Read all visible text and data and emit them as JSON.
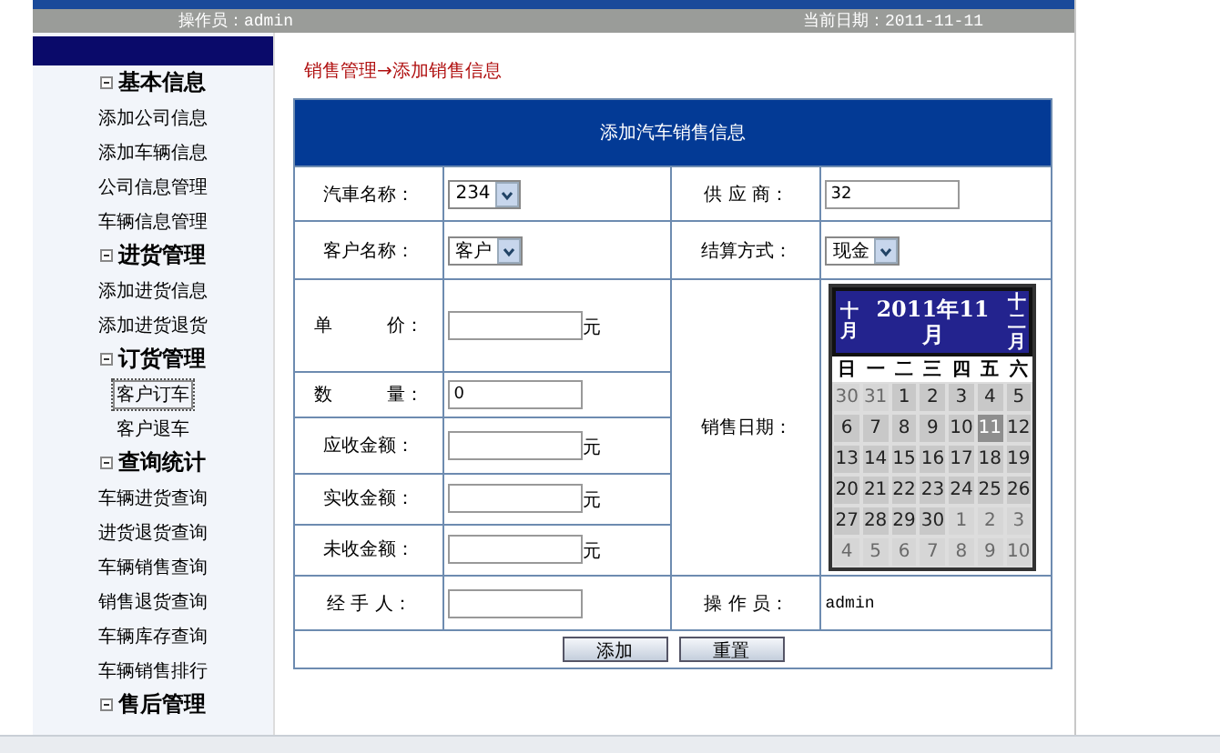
{
  "header": {
    "operator": "操作员：admin",
    "date": "当前日期：2011-11-11"
  },
  "sidebar": {
    "groups": [
      {
        "title": "基本信息",
        "expanded": true,
        "items": [
          {
            "label": "添加公司信息",
            "selected": false
          },
          {
            "label": "添加车辆信息",
            "selected": false
          },
          {
            "label": "公司信息管理",
            "selected": false
          },
          {
            "label": "车辆信息管理",
            "selected": false
          }
        ]
      },
      {
        "title": "进货管理",
        "expanded": true,
        "items": [
          {
            "label": "添加进货信息",
            "selected": false
          },
          {
            "label": "添加进货退货",
            "selected": false
          }
        ]
      },
      {
        "title": "订货管理",
        "expanded": true,
        "items": [
          {
            "label": "客户订车",
            "selected": true
          },
          {
            "label": "客户退车",
            "selected": false
          }
        ]
      },
      {
        "title": "查询统计",
        "expanded": true,
        "items": [
          {
            "label": "车辆进货查询",
            "selected": false
          },
          {
            "label": "进货退货查询",
            "selected": false
          },
          {
            "label": "车辆销售查询",
            "selected": false
          },
          {
            "label": "销售退货查询",
            "selected": false
          },
          {
            "label": "车辆库存查询",
            "selected": false
          },
          {
            "label": "车辆销售排行",
            "selected": false
          }
        ]
      },
      {
        "title": "售后管理",
        "expanded": true
      }
    ]
  },
  "breadcrumb": "销售管理→添加销售信息",
  "form": {
    "title": "添加汽车销售信息",
    "car_name": {
      "label": "汽車名称：",
      "value": "234"
    },
    "supplier": {
      "label": "供 应 商：",
      "value": "32"
    },
    "customer": {
      "label": "客户名称：",
      "value": "客户"
    },
    "settlement": {
      "label": "结算方式：",
      "value": "现金"
    },
    "unit_price": {
      "label": "单　　　价：",
      "unit": "元"
    },
    "quantity": {
      "label": "数　　　量：",
      "value": "0"
    },
    "receivable": {
      "label": "应收金额：",
      "unit": "元"
    },
    "received": {
      "label": "实收金额：",
      "unit": "元"
    },
    "outstanding": {
      "label": "未收金额：",
      "unit": "元"
    },
    "handler": {
      "label": "经 手 人："
    },
    "operator": {
      "label": "操 作 员：",
      "value": "admin"
    },
    "sale_date": {
      "label": "销售日期："
    },
    "buttons": [
      "添加",
      "重置"
    ]
  },
  "calendar": {
    "prev": "十月",
    "title": "2011年11月",
    "next": "十二月",
    "weekdays": [
      "日",
      "一",
      "二",
      "三",
      "四",
      "五",
      "六"
    ],
    "days": [
      {
        "label": "30",
        "muted": true,
        "selected": false
      },
      {
        "label": "31",
        "muted": true,
        "selected": false
      },
      {
        "label": "1",
        "muted": false,
        "selected": false
      },
      {
        "label": "2",
        "muted": false,
        "selected": false
      },
      {
        "label": "3",
        "muted": false,
        "selected": false
      },
      {
        "label": "4",
        "muted": false,
        "selected": false
      },
      {
        "label": "5",
        "muted": false,
        "selected": false
      },
      {
        "label": "6",
        "muted": false,
        "selected": false
      },
      {
        "label": "7",
        "muted": false,
        "selected": false
      },
      {
        "label": "8",
        "muted": false,
        "selected": false
      },
      {
        "label": "9",
        "muted": false,
        "selected": false
      },
      {
        "label": "10",
        "muted": false,
        "selected": false
      },
      {
        "label": "11",
        "muted": false,
        "selected": true
      },
      {
        "label": "12",
        "muted": false,
        "selected": false
      },
      {
        "label": "13",
        "muted": false,
        "selected": false
      },
      {
        "label": "14",
        "muted": false,
        "selected": false
      },
      {
        "label": "15",
        "muted": false,
        "selected": false
      },
      {
        "label": "16",
        "muted": false,
        "selected": false
      },
      {
        "label": "17",
        "muted": false,
        "selected": false
      },
      {
        "label": "18",
        "muted": false,
        "selected": false
      },
      {
        "label": "19",
        "muted": false,
        "selected": false
      },
      {
        "label": "20",
        "muted": false,
        "selected": false
      },
      {
        "label": "21",
        "muted": false,
        "selected": false
      },
      {
        "label": "22",
        "muted": false,
        "selected": false
      },
      {
        "label": "23",
        "muted": false,
        "selected": false
      },
      {
        "label": "24",
        "muted": false,
        "selected": false
      },
      {
        "label": "25",
        "muted": false,
        "selected": false
      },
      {
        "label": "26",
        "muted": false,
        "selected": false
      },
      {
        "label": "27",
        "muted": false,
        "selected": false
      },
      {
        "label": "28",
        "muted": false,
        "selected": false
      },
      {
        "label": "29",
        "muted": false,
        "selected": false
      },
      {
        "label": "30",
        "muted": false,
        "selected": false
      },
      {
        "label": "1",
        "muted": true,
        "selected": false
      },
      {
        "label": "2",
        "muted": true,
        "selected": false
      },
      {
        "label": "3",
        "muted": true,
        "selected": false
      },
      {
        "label": "4",
        "muted": true,
        "selected": false
      },
      {
        "label": "5",
        "muted": true,
        "selected": false
      },
      {
        "label": "6",
        "muted": true,
        "selected": false
      },
      {
        "label": "7",
        "muted": true,
        "selected": false
      },
      {
        "label": "8",
        "muted": true,
        "selected": false
      },
      {
        "label": "9",
        "muted": true,
        "selected": false
      },
      {
        "label": "10",
        "muted": true,
        "selected": false
      }
    ]
  }
}
